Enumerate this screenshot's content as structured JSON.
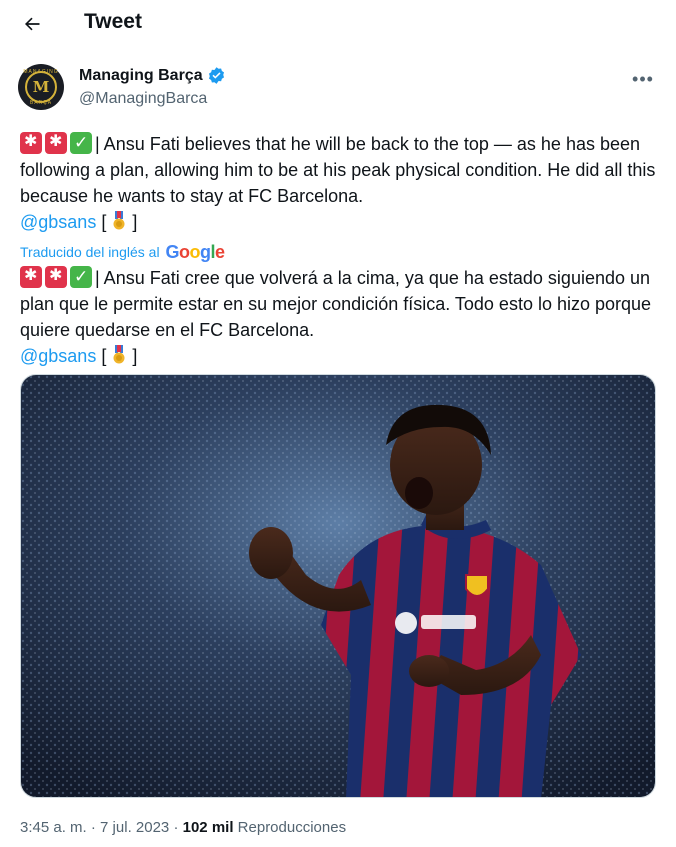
{
  "header": {
    "title": "Tweet",
    "back_icon": "arrow-left-icon"
  },
  "author": {
    "display_name": "Managing Barça",
    "handle": "@ManagingBarca",
    "verified": true,
    "avatar_letter": "M",
    "avatar_ring_top": "MANAGING",
    "avatar_ring_bottom": "BARÇA"
  },
  "tweet": {
    "original_prefix_icons": [
      "siren-icon",
      "siren-icon",
      "check-icon"
    ],
    "original_text": "| Ansu Fati believes that he will be back to the top — as he has been following a plan, allowing him to be at his peak physical condition. He did all this because he wants to stay at FC Barcelona.",
    "original_mention": "@gbsans",
    "original_bracket_open": "[",
    "original_bracket_close": "]",
    "translation_label": "Traducido del inglés al",
    "translation_provider": "Google",
    "translated_text": "| Ansu Fati cree que volverá a la cima, ya que ha estado siguiendo un plan que le permite estar en su mejor condición física. Todo esto lo hizo porque quiere quedarse en el FC Barcelona.",
    "translated_mention": "@gbsans",
    "translated_bracket_open": "[",
    "translated_bracket_close": "]"
  },
  "media": {
    "description_icon": "photo-football-player-celebrating"
  },
  "meta": {
    "time": "3:45 a. m.",
    "separator": "·",
    "date": "7 jul. 2023",
    "views_count": "102 mil",
    "views_label": "Reproducciones"
  },
  "colors": {
    "accent": "#1d9bf0",
    "text": "#0f1419",
    "secondary": "#536471",
    "badge_red": "#e0334b",
    "badge_green": "#45b549"
  }
}
